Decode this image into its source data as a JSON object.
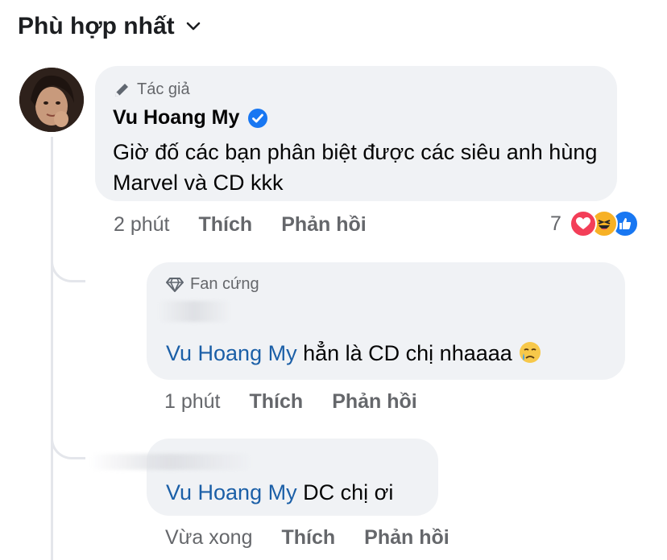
{
  "sort": {
    "label": "Phù hợp nhất"
  },
  "comments": [
    {
      "badge": "Tác giả",
      "author": "Vu Hoang My",
      "text": "Giờ đố các bạn phân biệt được các siêu anh hùng Marvel và CD kkk",
      "time": "2 phút",
      "like": "Thích",
      "reply": "Phản hồi",
      "reaction_count": "7"
    },
    {
      "badge": "Fan cứng",
      "mention": "Vu Hoang My",
      "text": " hẳn là CD chị nhaaaa",
      "time": "1 phút",
      "like": "Thích",
      "reply": "Phản hồi"
    },
    {
      "mention": "Vu Hoang My",
      "text": " DC chị ơi",
      "time": "Vừa xong",
      "like": "Thích",
      "reply": "Phản hồi"
    }
  ],
  "colors": {
    "bubble": "#f0f2f5",
    "mention": "#1b5fa7",
    "verified": "#1877f2",
    "meta": "#65676b"
  }
}
